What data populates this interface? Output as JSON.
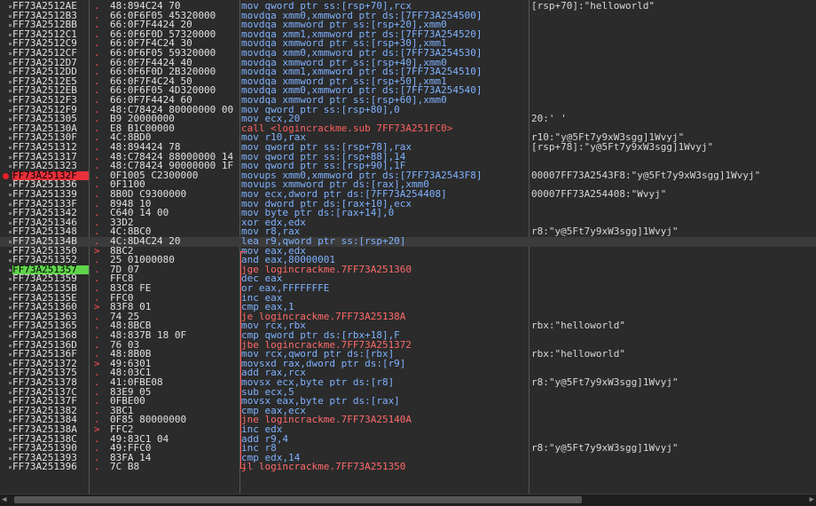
{
  "disassembly": {
    "rows": [
      {
        "addr": "FF73A2512AE",
        "mk": ".",
        "bytes": "48:894C24 70",
        "ins": "mov qword ptr ss:[rsp+70],rcx",
        "cmt": "[rsp+70]:\"helloworld\"",
        "t": "n"
      },
      {
        "addr": "FF73A2512B3",
        "mk": ".",
        "bytes": "66:0F6F05 45320000",
        "ins": "movdqa xmm0,xmmword ptr ds:[7FF73A254500]",
        "cmt": "",
        "t": "n"
      },
      {
        "addr": "FF73A2512BB",
        "mk": ".",
        "bytes": "66:0F7F4424 20",
        "ins": "movdqa xmmword ptr ss:[rsp+20],xmm0",
        "cmt": "",
        "t": "n"
      },
      {
        "addr": "FF73A2512C1",
        "mk": ".",
        "bytes": "66:0F6F0D 57320000",
        "ins": "movdqa xmm1,xmmword ptr ds:[7FF73A254520]",
        "cmt": "",
        "t": "n"
      },
      {
        "addr": "FF73A2512C9",
        "mk": ".",
        "bytes": "66:0F7F4C24 30",
        "ins": "movdqa xmmword ptr ss:[rsp+30],xmm1",
        "cmt": "",
        "t": "n"
      },
      {
        "addr": "FF73A2512CF",
        "mk": ".",
        "bytes": "66:0F6F05 59320000",
        "ins": "movdqa xmm0,xmmword ptr ds:[7FF73A254530]",
        "cmt": "",
        "t": "n"
      },
      {
        "addr": "FF73A2512D7",
        "mk": ".",
        "bytes": "66:0F7F4424 40",
        "ins": "movdqa xmmword ptr ss:[rsp+40],xmm0",
        "cmt": "",
        "t": "n"
      },
      {
        "addr": "FF73A2512DD",
        "mk": ".",
        "bytes": "66:0F6F0D 2B320000",
        "ins": "movdqa xmm1,xmmword ptr ds:[7FF73A254510]",
        "cmt": "",
        "t": "n"
      },
      {
        "addr": "FF73A2512E5",
        "mk": ".",
        "bytes": "66:0F7F4C24 50",
        "ins": "movdqa xmmword ptr ss:[rsp+50],xmm1",
        "cmt": "",
        "t": "n"
      },
      {
        "addr": "FF73A2512EB",
        "mk": ".",
        "bytes": "66:0F6F05 4D320000",
        "ins": "movdqa xmm0,xmmword ptr ds:[7FF73A254540]",
        "cmt": "",
        "t": "n"
      },
      {
        "addr": "FF73A2512F3",
        "mk": ".",
        "bytes": "66:0F7F4424 60",
        "ins": "movdqa xmmword ptr ss:[rsp+60],xmm0",
        "cmt": "",
        "t": "n"
      },
      {
        "addr": "FF73A2512F9",
        "mk": ".",
        "bytes": "48:C78424 80000000 00",
        "ins": "mov qword ptr ss:[rsp+80],0",
        "cmt": "",
        "t": "n"
      },
      {
        "addr": "FF73A251305",
        "mk": ".",
        "bytes": "B9 20000000",
        "ins": "mov ecx,20",
        "cmt": "20:' '",
        "t": "n"
      },
      {
        "addr": "FF73A25130A",
        "mk": ".",
        "bytes": "E8 B1C00000",
        "ins": "call <logincrackme.sub_7FF73A251FC0>",
        "cmt": "",
        "t": "call"
      },
      {
        "addr": "FF73A25130F",
        "mk": ".",
        "bytes": "4C:8BD0",
        "ins": "mov r10,rax",
        "cmt": "r10:\"y@5Ft7y9xW3sgg]1Wvyj\"",
        "t": "n"
      },
      {
        "addr": "FF73A251312",
        "mk": ".",
        "bytes": "48:894424 78",
        "ins": "mov qword ptr ss:[rsp+78],rax",
        "cmt": "[rsp+78]:\"y@5Ft7y9xW3sgg]1Wvyj\"",
        "t": "n"
      },
      {
        "addr": "FF73A251317",
        "mk": ".",
        "bytes": "48:C78424 88000000 14",
        "ins": "mov qword ptr ss:[rsp+88],14",
        "cmt": "",
        "t": "n"
      },
      {
        "addr": "FF73A251323",
        "mk": ".",
        "bytes": "48:C78424 90000000 1F",
        "ins": "mov qword ptr ss:[rsp+90],1F",
        "cmt": "",
        "t": "n"
      },
      {
        "addr": "FF73A25132F",
        "mk": ".",
        "bytes": "0F1005 C2300000",
        "ins": "movups xmm0,xmmword ptr ds:[7FF73A2543F8]",
        "cmt": "00007FF73A2543F8:\"y@5Ft7y9xW3sgg]1Wvyj\"",
        "t": "n",
        "hl": "red",
        "bp": true
      },
      {
        "addr": "FF73A251336",
        "mk": ".",
        "bytes": "0F1100",
        "ins": "movups xmmword ptr ds:[rax],xmm0",
        "cmt": "",
        "t": "n"
      },
      {
        "addr": "FF73A251339",
        "mk": ".",
        "bytes": "8B0D C9300000",
        "ins": "mov ecx,dword ptr ds:[7FF73A254408]",
        "cmt": "00007FF73A254408:\"Wvyj\"",
        "t": "n"
      },
      {
        "addr": "FF73A25133F",
        "mk": ".",
        "bytes": "8948 10",
        "ins": "mov dword ptr ds:[rax+10],ecx",
        "cmt": "",
        "t": "n"
      },
      {
        "addr": "FF73A251342",
        "mk": ".",
        "bytes": "C640 14 00",
        "ins": "mov byte ptr ds:[rax+14],0",
        "cmt": "",
        "t": "n"
      },
      {
        "addr": "FF73A251346",
        "mk": ".",
        "bytes": "33D2",
        "ins": "xor edx,edx",
        "cmt": "",
        "t": "n"
      },
      {
        "addr": "FF73A251348",
        "mk": ".",
        "bytes": "4C:8BC0",
        "ins": "mov r8,rax",
        "cmt": "r8:\"y@5Ft7y9xW3sgg]1Wvyj\"",
        "t": "n"
      },
      {
        "addr": "FF73A25134B",
        "mk": ".",
        "bytes": "4C:8D4C24 20",
        "ins": "lea r9,qword ptr ss:[rsp+20]",
        "cmt": "",
        "t": "n",
        "cur": true
      },
      {
        "addr": "FF73A251350",
        "mk": ">",
        "bytes": "8BC2",
        "ins": "mov eax,edx",
        "cmt": "",
        "t": "n"
      },
      {
        "addr": "FF73A251352",
        "mk": ".",
        "bytes": "25 01000080",
        "ins": "and eax,80000001",
        "cmt": "",
        "t": "n"
      },
      {
        "addr": "FF73A251357",
        "mk": ".",
        "bytes": "7D 07",
        "ins": "jge logincrackme.7FF73A251360",
        "cmt": "",
        "t": "jmp",
        "hl": "green"
      },
      {
        "addr": "FF73A251359",
        "mk": ".",
        "bytes": "FFC8",
        "ins": "dec eax",
        "cmt": "",
        "t": "n"
      },
      {
        "addr": "FF73A25135B",
        "mk": ".",
        "bytes": "83C8 FE",
        "ins": "or eax,FFFFFFFE",
        "cmt": "",
        "t": "n"
      },
      {
        "addr": "FF73A25135E",
        "mk": ".",
        "bytes": "FFC0",
        "ins": "inc eax",
        "cmt": "",
        "t": "n"
      },
      {
        "addr": "FF73A251360",
        "mk": ">",
        "bytes": "83F8 01",
        "ins": "cmp eax,1",
        "cmt": "",
        "t": "n"
      },
      {
        "addr": "FF73A251363",
        "mk": ".",
        "bytes": "74 25",
        "ins": "je logincrackme.7FF73A25138A",
        "cmt": "",
        "t": "jmp"
      },
      {
        "addr": "FF73A251365",
        "mk": ".",
        "bytes": "48:8BCB",
        "ins": "mov rcx,rbx",
        "cmt": "rbx:\"helloworld\"",
        "t": "n"
      },
      {
        "addr": "FF73A251368",
        "mk": ".",
        "bytes": "48:837B 18 0F",
        "ins": "cmp qword ptr ds:[rbx+18],F",
        "cmt": "",
        "t": "n"
      },
      {
        "addr": "FF73A25136D",
        "mk": ".",
        "bytes": "76 03",
        "ins": "jbe logincrackme.7FF73A251372",
        "cmt": "",
        "t": "jmp"
      },
      {
        "addr": "FF73A25136F",
        "mk": ".",
        "bytes": "48:8B0B",
        "ins": "mov rcx,qword ptr ds:[rbx]",
        "cmt": "rbx:\"helloworld\"",
        "t": "n"
      },
      {
        "addr": "FF73A251372",
        "mk": ">",
        "bytes": "49:6301",
        "ins": "movsxd rax,dword ptr ds:[r9]",
        "cmt": "",
        "t": "n"
      },
      {
        "addr": "FF73A251375",
        "mk": ".",
        "bytes": "48:03C1",
        "ins": "add rax,rcx",
        "cmt": "",
        "t": "n"
      },
      {
        "addr": "FF73A251378",
        "mk": ".",
        "bytes": "41:0FBE08",
        "ins": "movsx ecx,byte ptr ds:[r8]",
        "cmt": "r8:\"y@5Ft7y9xW3sgg]1Wvyj\"",
        "t": "n"
      },
      {
        "addr": "FF73A25137C",
        "mk": ".",
        "bytes": "83E9 05",
        "ins": "sub ecx,5",
        "cmt": "",
        "t": "n"
      },
      {
        "addr": "FF73A25137F",
        "mk": ".",
        "bytes": "0FBE00",
        "ins": "movsx eax,byte ptr ds:[rax]",
        "cmt": "",
        "t": "n"
      },
      {
        "addr": "FF73A251382",
        "mk": ".",
        "bytes": "3BC1",
        "ins": "cmp eax,ecx",
        "cmt": "",
        "t": "n"
      },
      {
        "addr": "FF73A251384",
        "mk": ".",
        "bytes": "0F85 80000000",
        "ins": "jne logincrackme.7FF73A25140A",
        "cmt": "",
        "t": "jmp"
      },
      {
        "addr": "FF73A25138A",
        "mk": ">",
        "bytes": "FFC2",
        "ins": "inc edx",
        "cmt": "",
        "t": "n"
      },
      {
        "addr": "FF73A25138C",
        "mk": ".",
        "bytes": "49:83C1 04",
        "ins": "add r9,4",
        "cmt": "",
        "t": "n"
      },
      {
        "addr": "FF73A251390",
        "mk": ".",
        "bytes": "49:FFC0",
        "ins": "inc r8",
        "cmt": "r8:\"y@5Ft7y9xW3sgg]1Wvyj\"",
        "t": "n"
      },
      {
        "addr": "FF73A251393",
        "mk": ".",
        "bytes": "83FA 14",
        "ins": "cmp edx,14",
        "cmt": "",
        "t": "n"
      },
      {
        "addr": "FF73A251396",
        "mk": ".",
        "bytes": "7C B8",
        "ins": "jl logincrackme.7FF73A251350",
        "cmt": "",
        "t": "jmp"
      }
    ]
  },
  "scrollbar": {
    "left_arrow": "◀",
    "right_arrow": "▶"
  }
}
